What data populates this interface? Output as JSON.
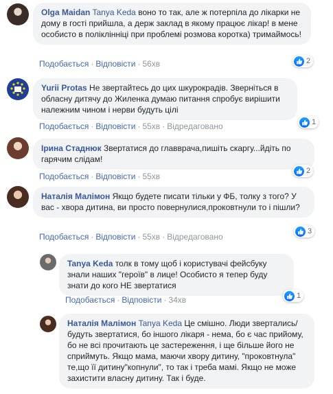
{
  "colors": {
    "author": "#385898",
    "link": "#4267b2",
    "meta": "#90949c",
    "bubble": "#f2f3f5",
    "like": "#1877f2"
  },
  "comments": [
    {
      "author": "Olga Maidan",
      "mention": "Tanya Keda",
      "text": "воно то так, але ж потерпіла до лікарки не дому в гості прийшла, а держ заклад в якому працює лікар! в мене особисто в поліклінніці при проблемі розмова коротка) тримаймось!",
      "like": "Подобається",
      "reply": "Відповісти",
      "time": "56хв",
      "edited": "",
      "reactions": "2",
      "reaction_icon": "like-icon"
    },
    {
      "author": "Yurii Protas",
      "mention": "",
      "text": "Не звертайтесь до цих шкурокрадів. Зверніться в обласну дитячу до Жиленка думаю питання спробує вирішити належним чином і нерви будуть цілі",
      "like": "Подобається",
      "reply": "Відповісти",
      "time": "55хв",
      "edited": "Відредаговано",
      "reactions": "1",
      "reaction_icon": "like-icon"
    },
    {
      "author": "Ірина Стаднюк",
      "mention": "",
      "text": "Звертатися до главврача,пишіть скаргу...йдіть по гарячим слідам!",
      "like": "Подобається",
      "reply": "Відповісти",
      "time": "55хв",
      "edited": "",
      "reactions": "2",
      "reaction_icon": "like-icon"
    },
    {
      "author": "Наталія Малімон",
      "mention": "",
      "text": "Якщо будете писати тільки у ФБ, толку з того? У вас - хвора дитина, ви просто повернулися,проковтнули то і пішли?",
      "like": "Подобається",
      "reply": "Відповісти",
      "time": "55хв",
      "edited": "Відредаговано",
      "reactions": "3",
      "reaction_icon": "like-icon"
    },
    {
      "author": "Tanya Keda",
      "mention": "",
      "text": "толк в тому щоб і користувачі фейсбуку знали наших \"героїв\" в лице! Особисто я тепер буду знати до кого НЕ звертатися",
      "like": "Подобається",
      "reply": "Відповісти",
      "time": "34хв",
      "edited": "",
      "reactions": "1",
      "reaction_icon": "like-icon"
    },
    {
      "author": "Наталія Малімон",
      "mention": "Tanya Keda",
      "text": "Це смішно. Люди звертались/будуть звертатися, бо іншого лікаря - нема, бо є час прийому, бо не всі прочитають це застереження, і ще більше його не сприймуть. Якщо мама, маючи хвору дитину, \"проковтнула\" те,що її дитину\"копнули\", то так і треба мамі. Якщо не може захистити власну дитину. Так і буде.",
      "like": "",
      "reply": "",
      "time": "",
      "edited": "",
      "reactions": "",
      "reaction_icon": ""
    }
  ]
}
